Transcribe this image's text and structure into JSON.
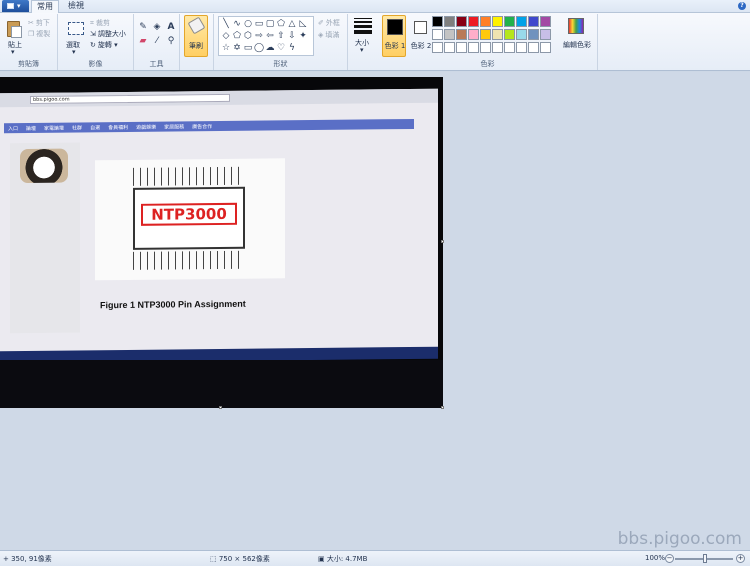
{
  "tabs": {
    "home": "常用",
    "view": "檢視"
  },
  "clipboard": {
    "paste": "貼上",
    "cut": "剪下",
    "copy": "複製",
    "label": "剪貼簿"
  },
  "image_group": {
    "select": "選取",
    "crop": "裁剪",
    "resize": "調整大小",
    "rotate": "旋轉",
    "label": "影像"
  },
  "tools": {
    "label": "工具",
    "text_tool": "A"
  },
  "brushes": {
    "label": "筆刷"
  },
  "shapes": {
    "outline": "外框",
    "fill": "填滿",
    "label": "形狀"
  },
  "size": {
    "label": "大小"
  },
  "colors": {
    "color1": "色彩 1",
    "color2": "色彩 2",
    "edit": "編輯色彩",
    "label": "色彩",
    "color1_hex": "#000000",
    "color2_hex": "#ffffff",
    "palette_row1": [
      "#000000",
      "#7f7f7f",
      "#880015",
      "#ed1c24",
      "#ff7f27",
      "#fff200",
      "#22b14c",
      "#00a2e8",
      "#3f48cc",
      "#a349a4"
    ],
    "palette_row2": [
      "#ffffff",
      "#c3c3c3",
      "#b97a57",
      "#ffaec9",
      "#ffc90e",
      "#efe4b0",
      "#b5e61d",
      "#99d9ea",
      "#7092be",
      "#c8bfe7"
    ],
    "palette_row3": [
      "#ffffff",
      "#ffffff",
      "#ffffff",
      "#ffffff",
      "#ffffff",
      "#ffffff",
      "#ffffff",
      "#ffffff",
      "#ffffff",
      "#ffffff"
    ]
  },
  "canvas_photo": {
    "url_text": "bbs.pigoo.com",
    "nav_items": [
      "入口",
      "論壇",
      "家電論壇",
      "社群",
      "自選",
      "會員福利",
      "遊戲娛樂",
      "家居服務",
      "廣告合作"
    ],
    "chip_label": "NTP3000",
    "caption": "Figure 1 NTP3000 Pin Assignment"
  },
  "watermark": "bbs.pigoo.com",
  "status": {
    "cursor_pos": "350, 91像素",
    "image_size": "750 × 562像素",
    "file_size": "大小: 4.7MB",
    "zoom": "100%"
  }
}
